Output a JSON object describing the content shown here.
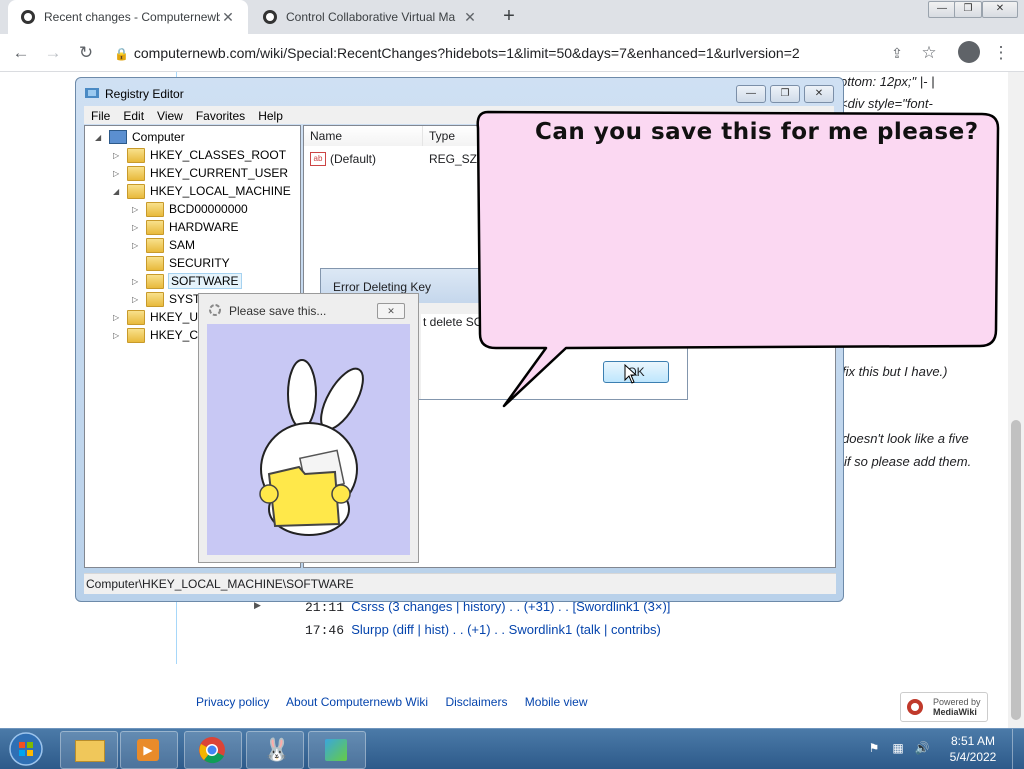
{
  "browser": {
    "tabs": [
      {
        "title": "Recent changes - Computernewb",
        "active": true
      },
      {
        "title": "Control Collaborative Virtual Ma",
        "active": false
      }
    ],
    "new_tab_symbol": "+",
    "url": "computernewb.com/wiki/Special:RecentChanges?hidebots=1&limit=50&days=7&enhanced=1&urlversion=2",
    "window_buttons": {
      "minimize": "—",
      "restore": "❐",
      "close": "✕"
    }
  },
  "wiki": {
    "snippet_lines": [
      {
        "text": "ottom: 12px;\" |- |",
        "italic": true
      },
      {
        "text": "<div style=\"font-",
        "italic": true
      },
      {
        "text": "fix this but I have.)",
        "italic": true
      },
      {
        "text": "doesn't look like a five",
        "italic": true
      },
      {
        "text": "if so please add them.",
        "italic": true
      }
    ],
    "changes": [
      {
        "time": "21:11",
        "page": "Csrss",
        "mid": "(3 changes | history) . . (+31) . .",
        "user": "[Swordlink1 (3×)]"
      },
      {
        "time": "17:46",
        "page": "Slurpp",
        "mid": "(diff | hist) . . (+1) . .",
        "user": "Swordlink1 (talk | contribs)"
      }
    ],
    "footer_links": [
      "Privacy policy",
      "About Computernewb Wiki",
      "Disclaimers",
      "Mobile view"
    ],
    "badge": {
      "line1": "Powered by",
      "line2": "MediaWiki"
    }
  },
  "regedit": {
    "title": "Registry Editor",
    "menu": [
      "File",
      "Edit",
      "View",
      "Favorites",
      "Help"
    ],
    "tree": [
      {
        "label": "Computer",
        "level": 0,
        "expander": "◢"
      },
      {
        "label": "HKEY_CLASSES_ROOT",
        "level": 1,
        "expander": "▷"
      },
      {
        "label": "HKEY_CURRENT_USER",
        "level": 1,
        "expander": "▷"
      },
      {
        "label": "HKEY_LOCAL_MACHINE",
        "level": 1,
        "expander": "◢"
      },
      {
        "label": "BCD00000000",
        "level": 2,
        "expander": "▷"
      },
      {
        "label": "HARDWARE",
        "level": 2,
        "expander": "▷"
      },
      {
        "label": "SAM",
        "level": 2,
        "expander": "▷"
      },
      {
        "label": "SECURITY",
        "level": 2,
        "expander": ""
      },
      {
        "label": "SOFTWARE",
        "level": 2,
        "expander": "▷",
        "selected": true
      },
      {
        "label": "SYSTE",
        "level": 2,
        "expander": "▷"
      },
      {
        "label": "HKEY_USE",
        "level": 1,
        "expander": "▷"
      },
      {
        "label": "HKEY_CU",
        "level": 1,
        "expander": "▷"
      }
    ],
    "columns": [
      "Name",
      "Type"
    ],
    "values": [
      {
        "name": "(Default)",
        "type": "REG_SZ"
      }
    ],
    "status": "Computer\\HKEY_LOCAL_MACHINE\\SOFTWARE"
  },
  "error_dialog": {
    "title": "Error Deleting Key",
    "message_fragment": "t delete SO",
    "ok_label": "OK"
  },
  "bubble": {
    "text": "Can you save this for me please?"
  },
  "popup": {
    "title": "Please save this..."
  },
  "taskbar": {
    "time": "8:51 AM",
    "date": "5/4/2022"
  },
  "colors": {
    "bubble_fill": "#fbd8f2",
    "popup_art_bg": "#c8c8f4",
    "link": "#0645ad"
  }
}
